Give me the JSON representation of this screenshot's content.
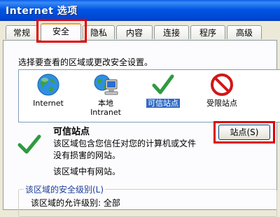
{
  "window": {
    "title": "Internet 选项"
  },
  "tabs": [
    {
      "label": "常规"
    },
    {
      "label": "安全"
    },
    {
      "label": "隐私"
    },
    {
      "label": "内容"
    },
    {
      "label": "连接"
    },
    {
      "label": "程序"
    },
    {
      "label": "高级"
    }
  ],
  "security": {
    "prompt": "选择要查看的区域或更改安全设置。",
    "zones": [
      {
        "label": "Internet",
        "icon": "globe-icon"
      },
      {
        "label": "本地\nIntranet",
        "icon": "computer-globe-icon"
      },
      {
        "label": "可信站点",
        "icon": "checkmark-icon",
        "selected": true
      },
      {
        "label": "受限站点",
        "icon": "no-entry-icon"
      }
    ],
    "selected_zone": {
      "heading": "可信站点",
      "description": "该区域包含您信任对您的计算机或文件没有损害的网站。",
      "note": "该区域中有网站。",
      "sites_button": "站点(S)"
    },
    "level_group": {
      "legend": "该区域的安全级别(L)",
      "allowed_level_label": "该区域的允许级别:",
      "allowed_level_value": "全部"
    }
  },
  "colors": {
    "highlight": "#e00000",
    "selection": "#316ac5",
    "active_tab_top": "#ff9a1a"
  }
}
